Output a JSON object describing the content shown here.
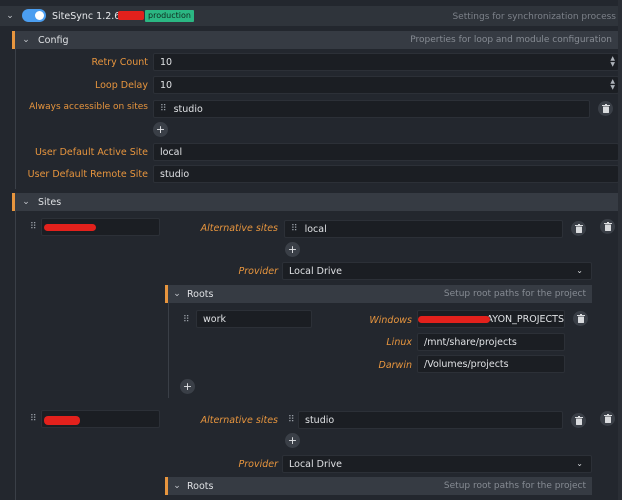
{
  "header": {
    "title": "SiteSync 1.2.6",
    "badge": "production",
    "description": "Settings for synchronization process"
  },
  "config": {
    "title": "Config",
    "description": "Properties for loop and module configuration",
    "retry_count_label": "Retry Count",
    "retry_count": "10",
    "loop_delay_label": "Loop Delay",
    "loop_delay": "10",
    "always_accessible_label": "Always accessible on sites",
    "always_accessible_value": "studio",
    "user_default_active_label": "User Default Active Site",
    "user_default_active": "local",
    "user_default_remote_label": "User Default Remote Site",
    "user_default_remote": "studio"
  },
  "sites": {
    "title": "Sites",
    "site1": {
      "alt_sites_label": "Alternative sites",
      "alt_site": "local",
      "provider_label": "Provider",
      "provider": "Local Drive",
      "roots_title": "Roots",
      "roots_description": "Setup root paths for the project",
      "root_name": "work",
      "windows_label": "Windows",
      "windows_value_suffix": "AYON_PROJECTS",
      "linux_label": "Linux",
      "linux_value": "/mnt/share/projects",
      "darwin_label": "Darwin",
      "darwin_value": "/Volumes/projects"
    },
    "site2": {
      "alt_sites_label": "Alternative sites",
      "alt_site": "studio",
      "provider_label": "Provider",
      "provider": "Local Drive",
      "roots_title": "Roots",
      "roots_description": "Setup root paths for the project"
    }
  },
  "icons": {
    "add": "+",
    "grip": "⠿",
    "chevron_down": "⌄",
    "accent_color": "#e7953e",
    "badge_color": "#2bb783",
    "toggle_color": "#4b9ef0"
  }
}
